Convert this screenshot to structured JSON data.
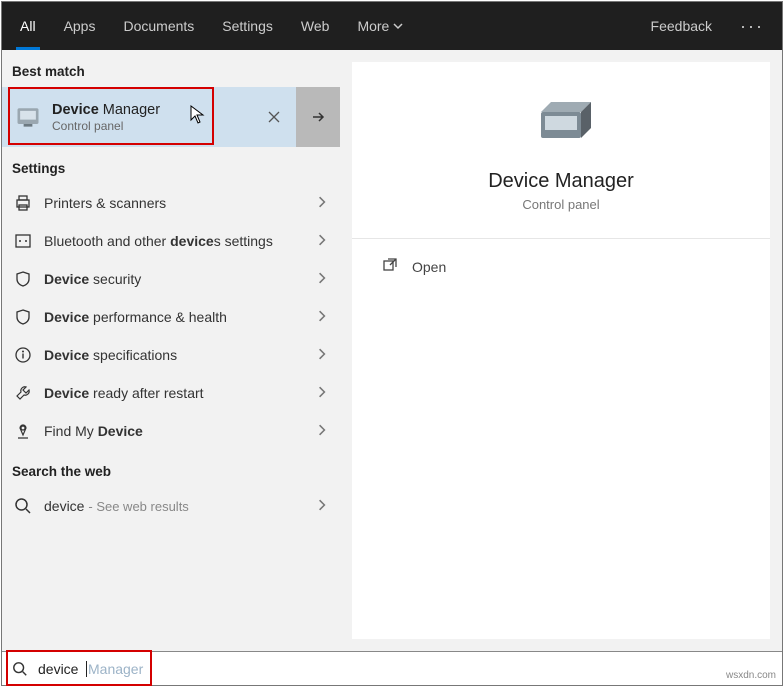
{
  "topbar": {
    "tabs": [
      "All",
      "Apps",
      "Documents",
      "Settings",
      "Web",
      "More"
    ],
    "active_index": 0,
    "feedback": "Feedback"
  },
  "sections": {
    "best_match": "Best match",
    "settings": "Settings",
    "search_web": "Search the web"
  },
  "best_match_item": {
    "title_bold": "Device",
    "title_rest": " Manager",
    "subtitle": "Control panel"
  },
  "settings_items": [
    {
      "icon": "printer",
      "pre": "",
      "bold": "",
      "post": "Printers & scanners"
    },
    {
      "icon": "bluetooth",
      "pre": "Bluetooth and other ",
      "bold": "device",
      "post": "s settings"
    },
    {
      "icon": "shield",
      "pre": "",
      "bold": "Device",
      "post": " security"
    },
    {
      "icon": "shield",
      "pre": "",
      "bold": "Device",
      "post": " performance & health"
    },
    {
      "icon": "info",
      "pre": "",
      "bold": "Device",
      "post": " specifications"
    },
    {
      "icon": "wrench",
      "pre": "",
      "bold": "Device",
      "post": " ready after restart"
    },
    {
      "icon": "locate",
      "pre": "Find My ",
      "bold": "Device",
      "post": ""
    }
  ],
  "web_result": {
    "term": "device",
    "hint": "See web results"
  },
  "preview": {
    "title": "Device Manager",
    "subtitle": "Control panel",
    "open_label": "Open"
  },
  "search": {
    "typed": "device",
    "ghost": " Manager"
  },
  "watermark": "wsxdn.com"
}
